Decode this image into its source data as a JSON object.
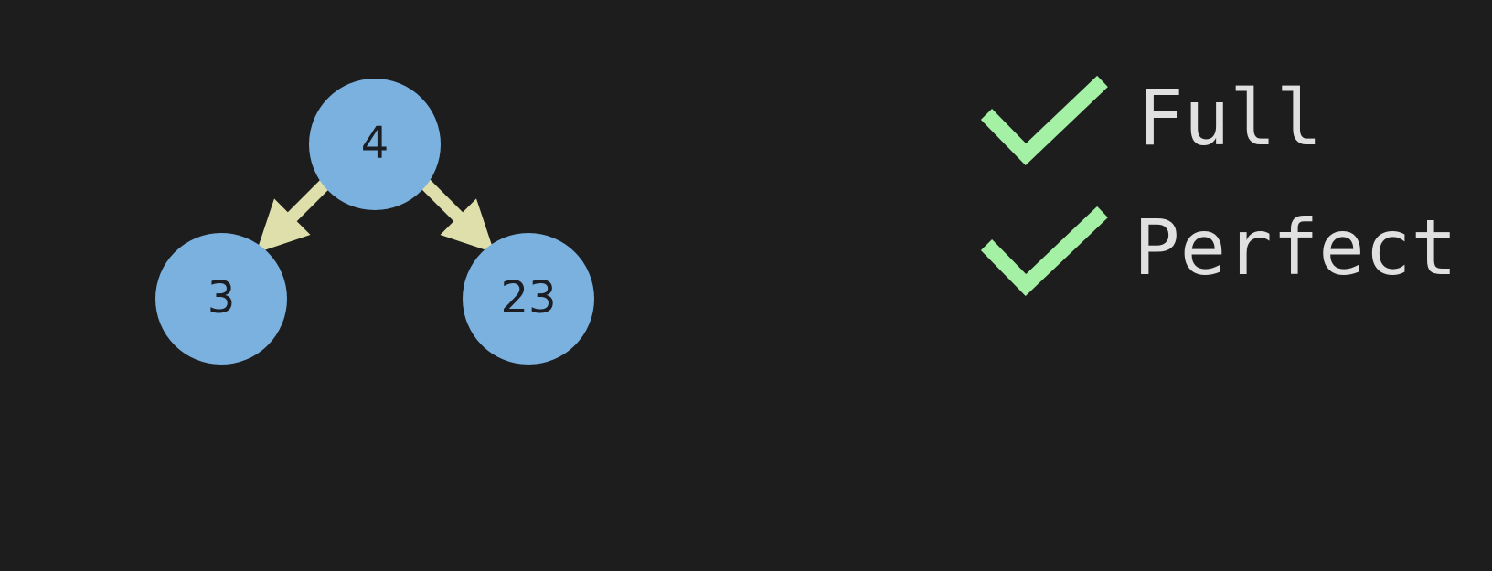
{
  "colors": {
    "background": "#1d1d1e",
    "node_fill": "#7ab1df",
    "node_text": "#1b1d22",
    "edge": "#dedfaa",
    "check": "#a4f0a4",
    "label_text": "#e0e0e0"
  },
  "tree": {
    "nodes": [
      {
        "id": "root",
        "value": "4"
      },
      {
        "id": "left",
        "value": "3"
      },
      {
        "id": "right",
        "value": "23"
      }
    ],
    "edges": [
      {
        "from": "root",
        "to": "left"
      },
      {
        "from": "root",
        "to": "right"
      }
    ]
  },
  "checklist": [
    {
      "label": "Full",
      "checked": true,
      "icon": "checkmark-icon"
    },
    {
      "label": "Perfect",
      "checked": true,
      "icon": "checkmark-icon"
    }
  ]
}
